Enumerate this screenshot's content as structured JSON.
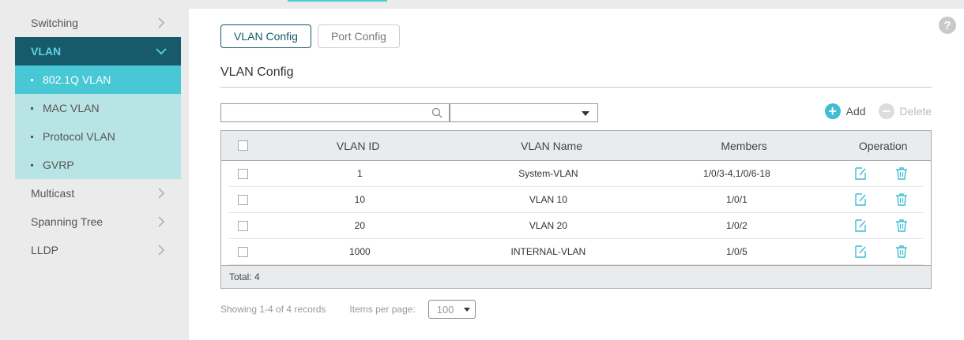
{
  "sidebar": {
    "items": [
      {
        "label": "Switching"
      },
      {
        "label": "VLAN"
      },
      {
        "label": "Multicast"
      },
      {
        "label": "Spanning Tree"
      },
      {
        "label": "LLDP"
      }
    ],
    "sub_items": [
      {
        "label": "802.1Q VLAN"
      },
      {
        "label": "MAC VLAN"
      },
      {
        "label": "Protocol VLAN"
      },
      {
        "label": "GVRP"
      }
    ]
  },
  "main": {
    "help_label": "?",
    "tabs": [
      {
        "label": "VLAN Config"
      },
      {
        "label": "Port Config"
      }
    ],
    "section_title": "VLAN Config",
    "actions": {
      "add_label": "Add",
      "delete_label": "Delete",
      "add_symbol": "+",
      "delete_symbol": "−"
    },
    "table": {
      "headers": [
        "VLAN ID",
        "VLAN Name",
        "Members",
        "Operation"
      ],
      "rows": [
        {
          "id": "1",
          "name": "System-VLAN",
          "members": "1/0/3-4,1/0/6-18"
        },
        {
          "id": "10",
          "name": "VLAN 10",
          "members": "1/0/1"
        },
        {
          "id": "20",
          "name": "VLAN 20",
          "members": "1/0/2"
        },
        {
          "id": "1000",
          "name": "INTERNAL-VLAN",
          "members": "1/0/5"
        }
      ],
      "total": "Total: 4"
    },
    "pager": {
      "showing": "Showing 1-4 of 4 records",
      "items_per_page_label": "Items per page:",
      "items_per_page_value": "100"
    }
  },
  "colors": {
    "active_nav_bg": "#165a6b",
    "active_nav_text": "#5fd3df",
    "active_sub_bg": "#47c8d4",
    "sub_bg": "#b9e4e5",
    "accent": "#3fbdd4"
  },
  "icons": [
    "chevron-right-icon",
    "chevron-down-icon",
    "search-icon",
    "dropdown-caret-icon",
    "add-circle-icon",
    "delete-circle-icon",
    "edit-icon",
    "trash-icon",
    "help-icon"
  ]
}
